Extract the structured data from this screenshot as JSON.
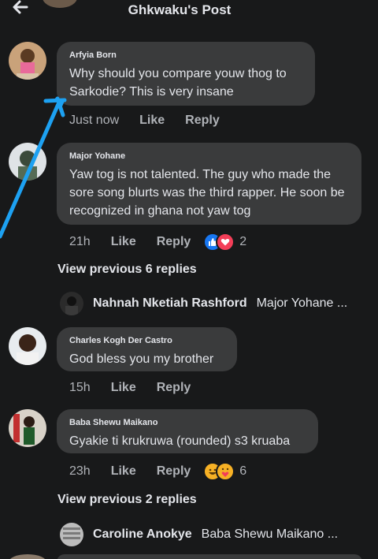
{
  "header": {
    "title": "Ghkwaku's Post"
  },
  "comments": [
    {
      "author": "Arfyia Born",
      "text": "Why should you compare youw thog to Sarkodie? This is very insane",
      "time": "Just now",
      "like": "Like",
      "reply": "Reply"
    },
    {
      "author": "Major Yohane",
      "text": "Yaw tog is not talented. The guy who made the sore song blurts was the third rapper. He soon be recognized in ghana not yaw tog",
      "time": "21h",
      "like": "Like",
      "reply": "Reply",
      "reaction_count": "2",
      "reactions": [
        "like-reaction-icon",
        "love-reaction-icon"
      ],
      "view_previous": "View previous 6 replies",
      "reply_preview": {
        "name": "Nahnah Nketiah Rashford",
        "text": "Major Yohane ..."
      }
    },
    {
      "author": "Charles Kogh Der Castro",
      "text": "God bless you my brother",
      "time": "15h",
      "like": "Like",
      "reply": "Reply"
    },
    {
      "author": "Baba Shewu Maikano",
      "text": "Gyakie ti krukruwa (rounded) s3 kruaba",
      "time": "23h",
      "like": "Like",
      "reply": "Reply",
      "reaction_count": "6",
      "reactions": [
        "haha-reaction-icon",
        "care-reaction-icon"
      ],
      "view_previous": "View previous 2 replies",
      "reply_preview": {
        "name": "Caroline Anokye",
        "text": "Baba Shewu Maikano ..."
      }
    }
  ],
  "colors": {
    "background": "#18191a",
    "bubble": "#3a3b3c",
    "text": "#e4e6eb",
    "secondary_text": "#b0b3b8",
    "annotation_arrow": "#1da1f2"
  }
}
